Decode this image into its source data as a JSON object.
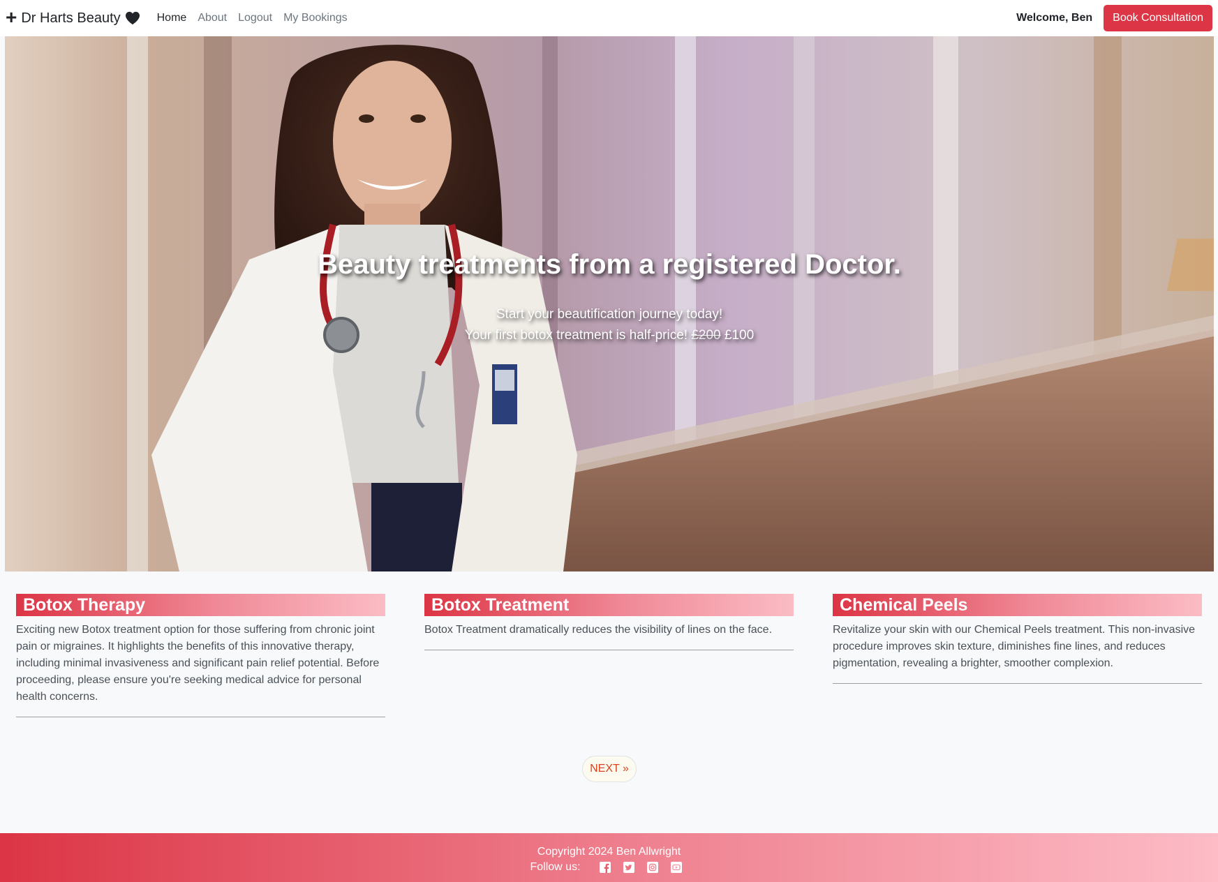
{
  "navbar": {
    "brand": "Dr Harts Beauty",
    "brand_icons": [
      "plus-icon",
      "heart-icon"
    ],
    "links": [
      {
        "label": "Home",
        "active": true
      },
      {
        "label": "About",
        "active": false
      },
      {
        "label": "Logout",
        "active": false
      },
      {
        "label": "My Bookings",
        "active": false
      }
    ],
    "welcome": "Welcome, Ben",
    "cta_label": "Book Consultation"
  },
  "hero": {
    "title": "Beauty treatments from a registered Doctor.",
    "line1": "Start your beautification journey today!",
    "line2_prefix": "Your first botox treatment is half-price!",
    "old_price": "£200",
    "new_price": "£100"
  },
  "cards": [
    {
      "title": "Botox Therapy",
      "body": "Exciting new Botox treatment option for those suffering from chronic joint pain or migraines. It highlights the benefits of this innovative therapy, including minimal invasiveness and significant pain relief potential. Before proceeding, please ensure you're seeking medical advice for personal health concerns."
    },
    {
      "title": "Botox Treatment",
      "body": "Botox Treatment dramatically reduces the visibility of lines on the face."
    },
    {
      "title": "Chemical Peels",
      "body": "Revitalize your skin with our Chemical Peels treatment. This non-invasive procedure improves skin texture, diminishes fine lines, and reduces pigmentation, revealing a brighter, smoother complexion."
    }
  ],
  "pagination": {
    "next_label": "NEXT »"
  },
  "footer": {
    "copyright": "Copyright 2024 Ben Allwright",
    "follow_label": "Follow us:",
    "social_icons": [
      "facebook-icon",
      "twitter-icon",
      "instagram-icon",
      "youtube-icon"
    ]
  },
  "colors": {
    "accent": "#dc3545",
    "gradient_end": "#fdbcc6",
    "next_text": "#d9441c"
  }
}
